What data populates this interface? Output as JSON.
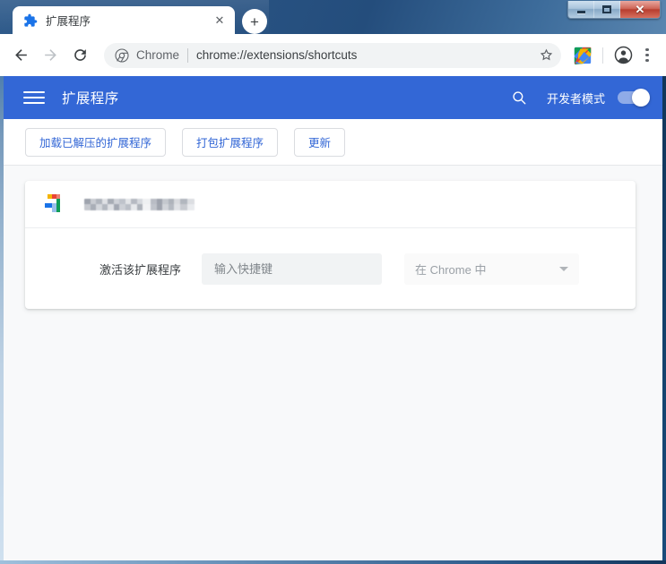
{
  "window": {
    "controls": {
      "minimize_label": "–",
      "maximize_label": "",
      "close_label": "✕"
    }
  },
  "tabs": [
    {
      "title": "扩展程序",
      "favicon": "puzzle-icon",
      "close_label": "✕"
    }
  ],
  "new_tab_label": "+",
  "toolbar": {
    "back_label": "←",
    "forward_label": "→",
    "reload_label": "↻",
    "omnibox": {
      "scheme_label": "Chrome",
      "url": "chrome://extensions/shortcuts",
      "divider": "|"
    },
    "bookmark_icon": "star-icon",
    "extension_icon": "extension-toolbar-icon",
    "profile_icon": "profile-avatar-icon",
    "menu_icon": "three-dot-menu-icon"
  },
  "ext_header": {
    "menu_icon": "hamburger-menu-icon",
    "title": "扩展程序",
    "search_icon": "search-icon",
    "devmode_label": "开发者模式",
    "devmode_on": true
  },
  "ext_actions": [
    {
      "label": "加载已解压的扩展程序"
    },
    {
      "label": "打包扩展程序"
    },
    {
      "label": "更新"
    }
  ],
  "shortcut_card": {
    "extension_icon": "google-extension-icon",
    "extension_name": "",
    "extension_name_redacted": true,
    "row": {
      "label": "激活该扩展程序",
      "input_value": "",
      "input_placeholder": "输入快捷键",
      "scope_value": "在 Chrome 中",
      "scope_caret_icon": "chevron-down-icon"
    }
  },
  "colors": {
    "header_blue": "#3367d6",
    "link_blue": "#3367d6",
    "page_bg": "#f8f9fa",
    "card_bg": "#ffffff",
    "input_bg": "#f1f3f4",
    "text_primary": "#3c4043",
    "text_muted": "#9aa0a6"
  }
}
